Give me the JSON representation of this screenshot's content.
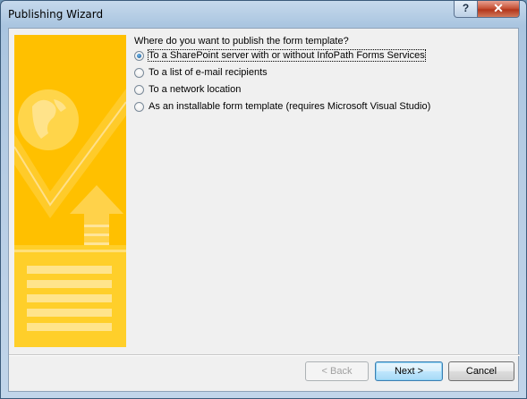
{
  "window": {
    "title": "Publishing Wizard",
    "help_glyph": "?",
    "close_glyph": "✕"
  },
  "question": "Where do you want to publish the form template?",
  "options": [
    {
      "label": "To a SharePoint server with or without InfoPath Forms Services",
      "selected": true
    },
    {
      "label": "To a list of e-mail recipients",
      "selected": false
    },
    {
      "label": "To a network location",
      "selected": false
    },
    {
      "label": "As an installable form template (requires Microsoft Visual Studio)",
      "selected": false
    }
  ],
  "buttons": {
    "back": "< Back",
    "next": "Next >",
    "cancel": "Cancel"
  },
  "colors": {
    "panel": "#ffc000",
    "accent": "#3c7fb1"
  }
}
